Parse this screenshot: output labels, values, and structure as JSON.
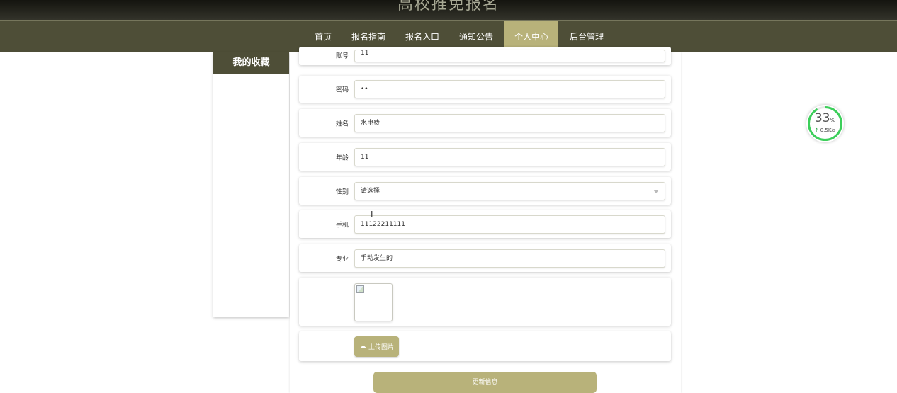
{
  "site": {
    "title": "高校推免报名"
  },
  "nav": {
    "items": [
      {
        "label": "首页"
      },
      {
        "label": "报名指南"
      },
      {
        "label": "报名入口"
      },
      {
        "label": "通知公告"
      },
      {
        "label": "个人中心"
      },
      {
        "label": "后台管理"
      }
    ],
    "active_index": 4
  },
  "sidebar": {
    "header": "我的收藏"
  },
  "form": {
    "account": {
      "label": "账号",
      "value": "11"
    },
    "password": {
      "label": "密码",
      "value": "••"
    },
    "name": {
      "label": "姓名",
      "value": "水电费"
    },
    "age": {
      "label": "年龄",
      "value": "11"
    },
    "gender": {
      "label": "性别",
      "value": "请选择"
    },
    "phone": {
      "label": "手机",
      "value": "11122211111"
    },
    "major": {
      "label": "专业",
      "value": "手动发生的"
    },
    "upload_label": "上传图片",
    "submit_label": "更新信息"
  },
  "speed_widget": {
    "percent": "33",
    "percent_unit": "%",
    "percent_value": 33,
    "rate": "0.5K/s"
  },
  "colors": {
    "nav_bg": "#4e4e37",
    "accent": "#b8b27a",
    "progress": "#3ccf5a"
  },
  "icons": {
    "upload": "cloud-upload-icon",
    "select": "chevron-down-icon",
    "cursor": "text-cursor-icon",
    "rate_arrow": "arrow-up-icon"
  }
}
